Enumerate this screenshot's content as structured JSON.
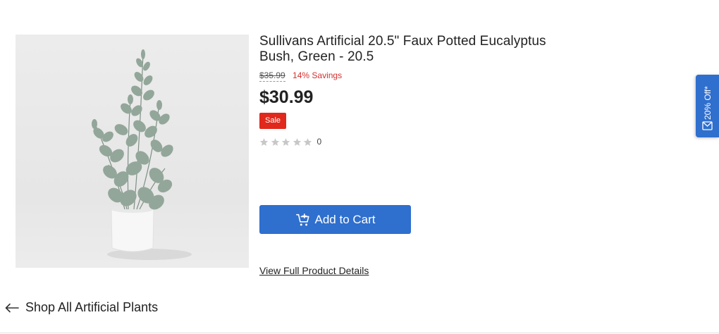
{
  "product": {
    "title": "Sullivans Artificial 20.5\" Faux Potted Eucalyptus Bush, Green - 20.5",
    "original_price": "$35.99",
    "savings": "14% Savings",
    "price": "$30.99",
    "badge": "Sale",
    "rating": 0,
    "rating_max": 5,
    "review_count": "0",
    "image_icon": "eucalyptus-plant-photo"
  },
  "actions": {
    "add_to_cart": "Add to Cart",
    "view_details": "View Full Product Details"
  },
  "navigation": {
    "shop_all": "Shop All Artificial Plants"
  },
  "promo_tab": {
    "label": "20% Off*",
    "icon": "envelope-icon"
  },
  "colors": {
    "accent": "#2f6fce",
    "sale": "#e0281c",
    "savings_text": "#d32f2f",
    "star_empty": "#c8c8c8"
  }
}
